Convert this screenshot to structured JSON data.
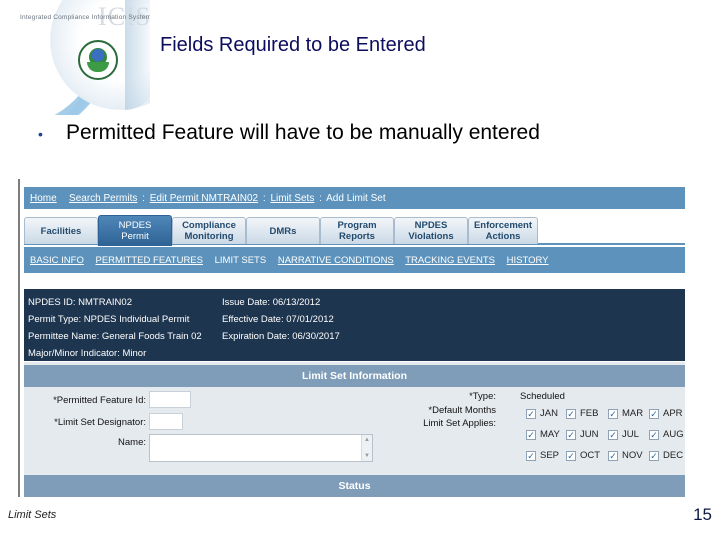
{
  "slide": {
    "logo_system_name": "Integrated Compliance Information System",
    "logo_mark": "ICIS",
    "title": "Fields Required to be Entered",
    "bullet": "Permitted Feature will have to be manually entered",
    "footer_label": "Limit Sets",
    "page_number": "15"
  },
  "app": {
    "breadcrumb": [
      {
        "label": "Home",
        "link": true
      },
      {
        "label": "Search Permits",
        "link": true
      },
      {
        "label": "Edit Permit NMTRAIN02",
        "link": true
      },
      {
        "label": "Limit Sets",
        "link": true
      },
      {
        "label": "Add Limit Set",
        "link": false
      }
    ],
    "breadcrumb_separator": ":",
    "tabs": [
      {
        "label": "Facilities",
        "active": false
      },
      {
        "label": "NPDES Permit",
        "active": true
      },
      {
        "label": "Compliance Monitoring",
        "active": false
      },
      {
        "label": "DMRs",
        "active": false
      },
      {
        "label": "Program Reports",
        "active": false
      },
      {
        "label": "NPDES Violations",
        "active": false
      },
      {
        "label": "Enforcement Actions",
        "active": false
      }
    ],
    "subnav": [
      {
        "label": "BASIC INFO",
        "link": true
      },
      {
        "label": "PERMITTED FEATURES",
        "link": true
      },
      {
        "label": "LIMIT SETS",
        "link": false
      },
      {
        "label": "NARRATIVE CONDITIONS",
        "link": true
      },
      {
        "label": "TRACKING EVENTS",
        "link": true
      },
      {
        "label": "HISTORY",
        "link": true
      }
    ],
    "permit_info": {
      "npdes_id": "NPDES ID: NMTRAIN02",
      "permit_type": "Permit Type: NPDES Individual Permit",
      "permittee_name": "Permittee Name: General Foods Train 02",
      "major_minor": "Major/Minor Indicator: Minor",
      "issue_date": "Issue Date: 06/13/2012",
      "effective_date": "Effective Date: 07/01/2012",
      "expiration_date": "Expiration Date: 06/30/2017"
    },
    "limit_set_section": {
      "header": "Limit Set Information",
      "permitted_feature_label": "*Permitted Feature Id:",
      "permitted_feature_value": "",
      "designator_label": "*Limit Set Designator:",
      "designator_value": "",
      "name_label": "Name:",
      "name_value": "",
      "type_label": "*Type:",
      "type_value": "Scheduled",
      "months_label_1": "*Default Months",
      "months_label_2": "Limit Set Applies:",
      "months": [
        {
          "label": "JAN",
          "checked": true
        },
        {
          "label": "FEB",
          "checked": true
        },
        {
          "label": "MAR",
          "checked": true
        },
        {
          "label": "APR",
          "checked": true
        },
        {
          "label": "MAY",
          "checked": true
        },
        {
          "label": "JUN",
          "checked": true
        },
        {
          "label": "JUL",
          "checked": true
        },
        {
          "label": "AUG",
          "checked": true
        },
        {
          "label": "SEP",
          "checked": true
        },
        {
          "label": "OCT",
          "checked": true
        },
        {
          "label": "NOV",
          "checked": true
        },
        {
          "label": "DEC",
          "checked": true
        }
      ]
    },
    "status_section": {
      "header": "Status"
    },
    "icons": {
      "checkbox_checked": "✓",
      "scroll_up": "▲",
      "scroll_down": "▼",
      "bullet": "•"
    }
  },
  "colors": {
    "title_navy": "#0d0d5e",
    "nav_blue": "#5c92bb",
    "info_panel": "#1e354f",
    "section_header": "#7f9db8",
    "form_bg": "#e5eaef"
  }
}
